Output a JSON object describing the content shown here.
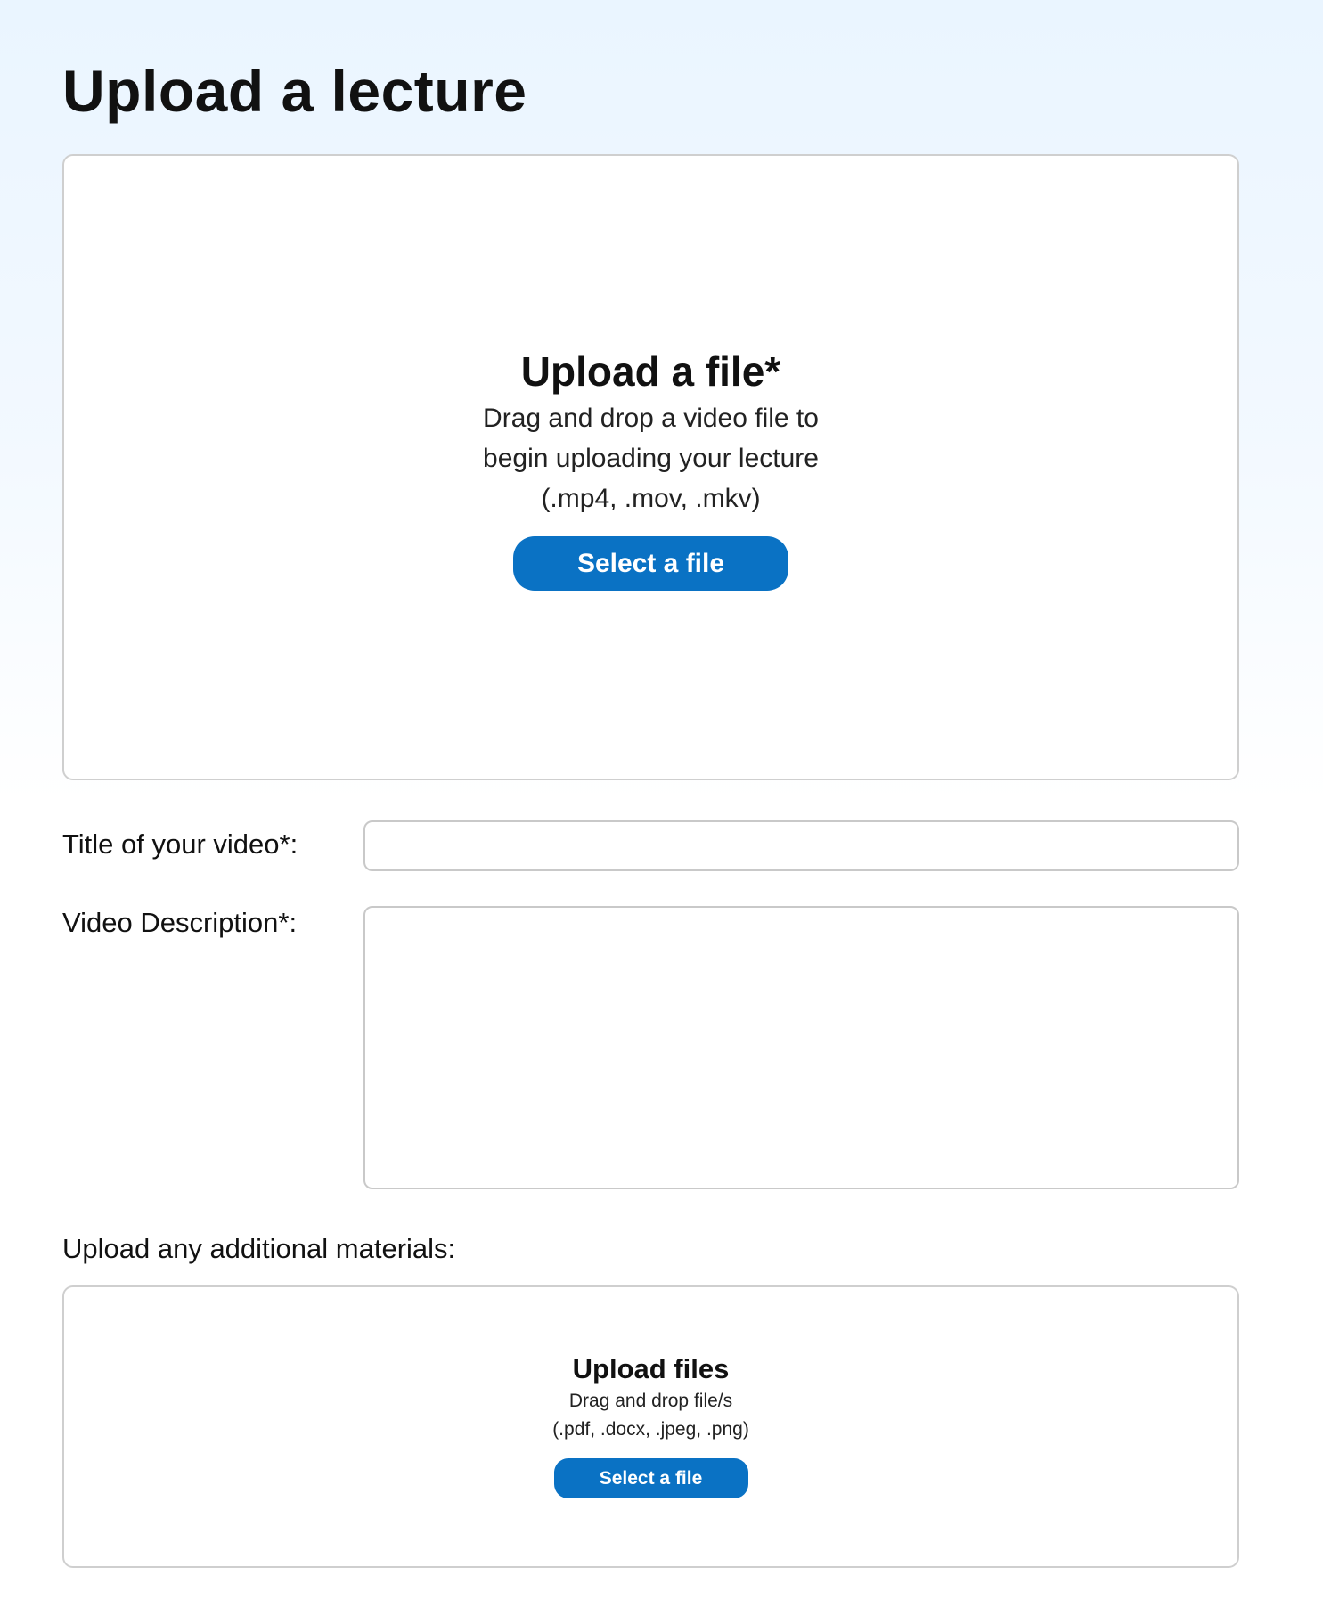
{
  "page": {
    "title": "Upload a lecture"
  },
  "video_upload": {
    "title": "Upload a file*",
    "description_lines": [
      "Drag and drop a video file to",
      "begin uploading your lecture",
      "(.mp4, .mov,  .mkv)"
    ],
    "button_label": "Select a file"
  },
  "form": {
    "title_label": "Title of your video*:",
    "title_value": "",
    "description_label": "Video Description*:",
    "description_value": ""
  },
  "materials": {
    "label": "Upload any additional materials:",
    "title": "Upload files",
    "description_lines": [
      "Drag and drop file/s",
      "(.pdf, .docx, .jpeg, .png)"
    ],
    "button_label": "Select a file"
  },
  "colors": {
    "accent": "#0a72c4",
    "background_top": "#eaf5ff",
    "border": "#cfcfcf"
  }
}
